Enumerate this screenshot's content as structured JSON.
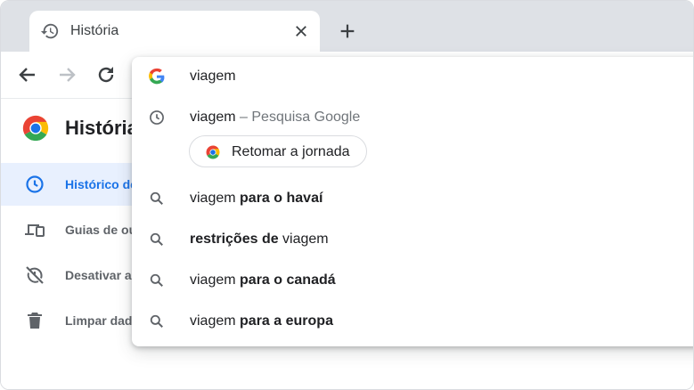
{
  "tab": {
    "title": "História"
  },
  "page": {
    "title": "História",
    "sidebar": [
      {
        "label": "Histórico de",
        "icon": "clock-icon",
        "active": true
      },
      {
        "label": "Guias de ou",
        "icon": "devices-icon",
        "active": false
      },
      {
        "label": "Desativar a",
        "icon": "history-off-icon",
        "active": false
      },
      {
        "label": "Limpar dad",
        "icon": "trash-icon",
        "active": false
      }
    ]
  },
  "omnibox": {
    "input_text": "viagem",
    "history_suggestion": {
      "query": "viagem",
      "separator": " – ",
      "source": "Pesquisa Google"
    },
    "journey_chip": "Retomar a jornada",
    "suggestions": [
      {
        "prefix": "viagem ",
        "bold": "para o havaí",
        "suffix": ""
      },
      {
        "prefix": "",
        "bold": "restrições de",
        "suffix": " viagem"
      },
      {
        "prefix": "viagem ",
        "bold": "para o canadá",
        "suffix": ""
      },
      {
        "prefix": "viagem ",
        "bold": "para a europa",
        "suffix": ""
      }
    ]
  },
  "colors": {
    "accent": "#1a73e8",
    "active_bg": "#e8f0fe",
    "tabstrip": "#dee1e6"
  }
}
